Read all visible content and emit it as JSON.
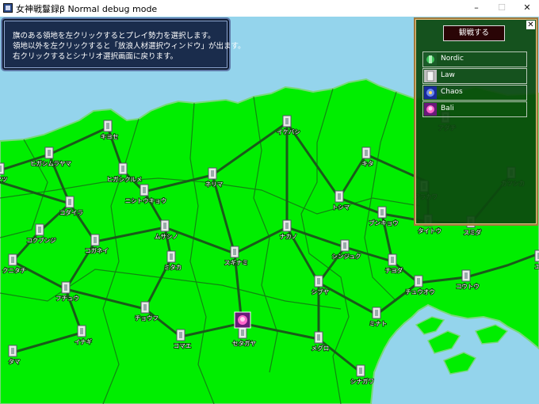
{
  "window": {
    "title": "女神戦鬘録β  Normal  debug mode",
    "minimize_glyph": "–",
    "maximize_glyph": "☐",
    "close_glyph": "✕"
  },
  "info_box": {
    "lines": [
      "旗のある領地を左クリックするとプレイ勢力を選択します。",
      "領地以外を左クリックすると「放浪人材選択ウィンドウ」が出ます。",
      "右クリックするとシナリオ選択画面に戻ります。"
    ]
  },
  "faction_panel": {
    "close_glyph": "✕",
    "watch_button": "観戦する",
    "factions": [
      {
        "name": "Nordic",
        "color": "#2e9a3a"
      },
      {
        "name": "Law",
        "color": "#d8d8d8"
      },
      {
        "name": "Chaos",
        "color": "#3050d0"
      },
      {
        "name": "Bali",
        "color": "#c03a9a"
      }
    ]
  },
  "map": {
    "colors": {
      "land": "#00ee00",
      "sea": "#94d4ec",
      "road": "#1a5a1a",
      "border": "#7ad87a"
    },
    "territories": [
      {
        "name": "キヨセ"
      },
      {
        "name": "イケバシ"
      },
      {
        "name": "ヒガシムラヤマ"
      },
      {
        "name": "ヒガシクルメ"
      },
      {
        "name": "キタ"
      },
      {
        "name": "ネリマ"
      },
      {
        "name": "ニシトウキョウ"
      },
      {
        "name": "トシマ"
      },
      {
        "name": "アダチ"
      },
      {
        "name": "アラカワ"
      },
      {
        "name": "カツシカ"
      },
      {
        "name": "コダイラ"
      },
      {
        "name": "ブンキョウ"
      },
      {
        "name": "タイトウ"
      },
      {
        "name": "スミダ"
      },
      {
        "name": "ムサシノ"
      },
      {
        "name": "コクブンジ"
      },
      {
        "name": "ナカノ"
      },
      {
        "name": "コガネイ"
      },
      {
        "name": "スギナミ"
      },
      {
        "name": "シンジュク"
      },
      {
        "name": "チヨダ"
      },
      {
        "name": "エド"
      },
      {
        "name": "クニタチ"
      },
      {
        "name": "ミタカ"
      },
      {
        "name": "シブヤ"
      },
      {
        "name": "チュウオウ"
      },
      {
        "name": "コウトウ"
      },
      {
        "name": "フチュウ"
      },
      {
        "name": "チョウフ"
      },
      {
        "name": "ミナト"
      },
      {
        "name": "セタガヤ"
      },
      {
        "name": "イナギ"
      },
      {
        "name": "コマエ"
      },
      {
        "name": "メグロ"
      },
      {
        "name": "タマ"
      },
      {
        "name": "シナガワ"
      },
      {
        "name": "マツ"
      }
    ]
  }
}
